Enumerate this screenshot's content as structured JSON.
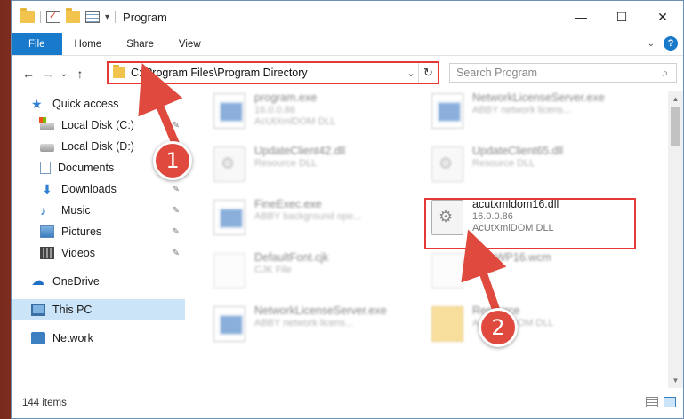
{
  "window": {
    "title": "Program",
    "minimize": "—",
    "maximize": "☐",
    "close": "✕"
  },
  "ribbon": {
    "tabs": [
      "File",
      "Home",
      "Share",
      "View"
    ],
    "help": "?"
  },
  "address": {
    "path": "C:\\Program Files\\Program Directory",
    "back": "←",
    "forward": "→",
    "recent": "⌄",
    "up": "↑",
    "refresh": "↻"
  },
  "search": {
    "placeholder": "Search Program",
    "icon": "search-icon"
  },
  "sidebar": {
    "items": [
      {
        "label": "Quick access",
        "icon": "star-icon",
        "pinned": false
      },
      {
        "label": "Local Disk (C:)",
        "icon": "drive-c-icon",
        "pinned": true
      },
      {
        "label": "Local Disk (D:)",
        "icon": "drive-icon",
        "pinned": false
      },
      {
        "label": "Documents",
        "icon": "documents-icon",
        "pinned": true
      },
      {
        "label": "Downloads",
        "icon": "download-icon",
        "pinned": true
      },
      {
        "label": "Music",
        "icon": "music-icon",
        "pinned": true
      },
      {
        "label": "Pictures",
        "icon": "pictures-icon",
        "pinned": true
      },
      {
        "label": "Videos",
        "icon": "videos-icon",
        "pinned": true
      },
      {
        "label": "OneDrive",
        "icon": "onedrive-icon",
        "pinned": false
      },
      {
        "label": "This PC",
        "icon": "this-pc-icon",
        "pinned": false
      },
      {
        "label": "Network",
        "icon": "network-icon",
        "pinned": false
      }
    ],
    "pin_glyph": "📌"
  },
  "files": [
    {
      "name": "program.exe",
      "line1": "16.0.0.86",
      "line2": "AcUtXmlDOM DLL",
      "type": "exe"
    },
    {
      "name": "NetworkLicenseServer.exe",
      "line1": "ABBY network licens...",
      "line2": "",
      "type": "exe"
    },
    {
      "name": "UpdateClient42.dll",
      "line1": "Resource DLL",
      "line2": "",
      "type": "dll"
    },
    {
      "name": "UpdateClient65.dll",
      "line1": "Resource DLL",
      "line2": "",
      "type": "dll"
    },
    {
      "name": "FineExec.exe",
      "line1": "ABBY background ope...",
      "line2": "",
      "type": "exe"
    },
    {
      "name": "acutxmldom16.dll",
      "line1": "16.0.0.86",
      "line2": "AcUtXmlDOM DLL",
      "type": "dll"
    },
    {
      "name": "DefaultFont.cjk",
      "line1": "CJK File",
      "line2": "",
      "type": "plain"
    },
    {
      "name": "...EoWP16.wcm",
      "line1": "...File",
      "line2": "",
      "type": "plain"
    },
    {
      "name": "NetworkLicenseServer.exe",
      "line1": "ABBY network licens...",
      "line2": "",
      "type": "exe"
    },
    {
      "name": "Resource",
      "line1": "AcUtXmlDOM DLL",
      "line2": "",
      "type": "folderlike"
    }
  ],
  "status": {
    "count": "144 items"
  },
  "annotations": {
    "step1": "1",
    "step2": "2",
    "color": "#e04a3e"
  }
}
